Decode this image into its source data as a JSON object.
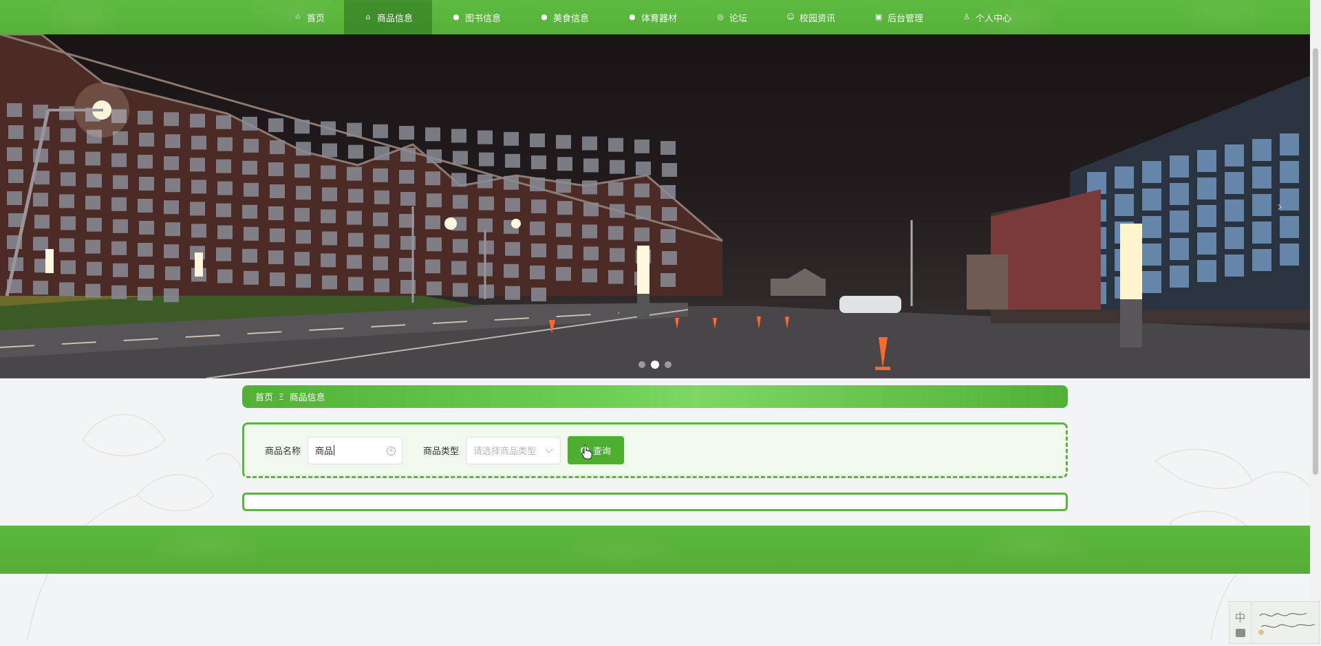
{
  "nav": {
    "items": [
      {
        "label": "首页",
        "icon": "star-icon",
        "active": false
      },
      {
        "label": "商品信息",
        "icon": "bag-icon",
        "active": true
      },
      {
        "label": "图书信息",
        "icon": "info-icon",
        "active": false
      },
      {
        "label": "美食信息",
        "icon": "question-icon",
        "active": false
      },
      {
        "label": "体育器材",
        "icon": "info-icon",
        "active": false
      },
      {
        "label": "论坛",
        "icon": "forum-icon",
        "active": false
      },
      {
        "label": "校园资讯",
        "icon": "smile-icon",
        "active": false
      },
      {
        "label": "后台管理",
        "icon": "box-icon",
        "active": false
      },
      {
        "label": "个人中心",
        "icon": "user-icon",
        "active": false
      }
    ]
  },
  "banner": {
    "slide_count": 3,
    "active_slide": 2
  },
  "breadcrumb": {
    "home": "首页",
    "separator": "Ξ",
    "current": "商品信息"
  },
  "search": {
    "name_label": "商品名称",
    "name_value": "商品",
    "type_label": "商品类型",
    "type_placeholder": "请选择商品类型",
    "query_label": "查询"
  },
  "ime": {
    "mode_label": "中"
  },
  "colors": {
    "primary_green": "#56b13a",
    "active_nav": "#3f8f2a",
    "button_green": "#4caf30"
  }
}
